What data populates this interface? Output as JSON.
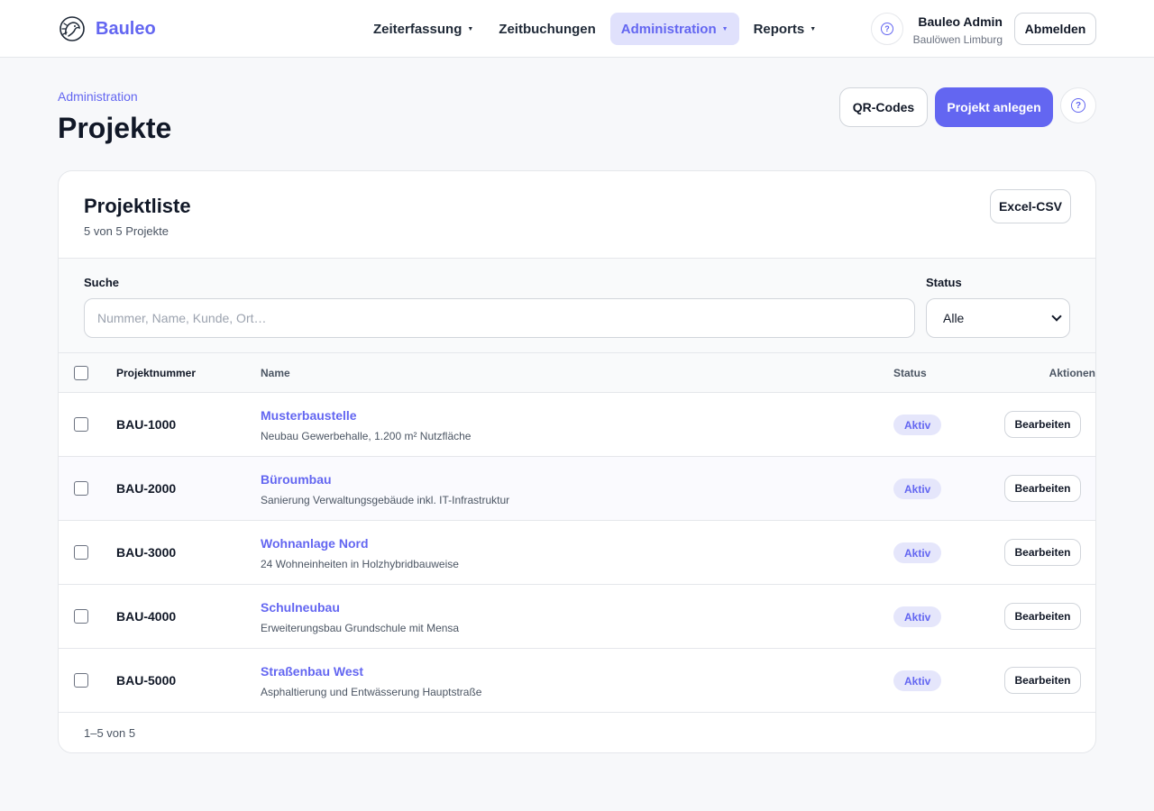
{
  "header": {
    "brand": "Bauleo",
    "nav": [
      {
        "label": "Zeiterfassung",
        "has_dropdown": true,
        "active": false
      },
      {
        "label": "Zeitbuchungen",
        "has_dropdown": false,
        "active": false
      },
      {
        "label": "Administration",
        "has_dropdown": true,
        "active": true
      },
      {
        "label": "Reports",
        "has_dropdown": true,
        "active": false
      }
    ],
    "user_name": "Bauleo Admin",
    "user_org": "Baulöwen Limburg",
    "logout_label": "Abmelden"
  },
  "page": {
    "breadcrumb": "Administration",
    "title": "Projekte",
    "qr_label": "QR-Codes",
    "create_label": "Projekt anlegen"
  },
  "card": {
    "title": "Projektliste",
    "subtitle": "5 von 5 Projekte",
    "export_label": "Excel-CSV",
    "search_label": "Suche",
    "search_placeholder": "Nummer, Name, Kunde, Ort…",
    "search_value": "",
    "status_label": "Status",
    "status_value": "Alle",
    "columns": [
      "Projektnummer",
      "Name",
      "Status",
      "Aktionen"
    ],
    "rows": [
      {
        "number": "BAU-1000",
        "name": "Musterbaustelle",
        "description": "Neubau Gewerbehalle, 1.200 m² Nutzfläche",
        "status": "Aktiv",
        "action": "Bearbeiten"
      },
      {
        "number": "BAU-2000",
        "name": "Büroumbau",
        "description": "Sanierung Verwaltungsgebäude inkl. IT-Infrastruktur",
        "status": "Aktiv",
        "action": "Bearbeiten"
      },
      {
        "number": "BAU-3000",
        "name": "Wohnanlage Nord",
        "description": "24 Wohneinheiten in Holzhybridbauweise",
        "status": "Aktiv",
        "action": "Bearbeiten"
      },
      {
        "number": "BAU-4000",
        "name": "Schulneubau",
        "description": "Erweiterungsbau Grundschule mit Mensa",
        "status": "Aktiv",
        "action": "Bearbeiten"
      },
      {
        "number": "BAU-5000",
        "name": "Straßenbau West",
        "description": "Asphaltierung und Entwässerung Hauptstraße",
        "status": "Aktiv",
        "action": "Bearbeiten"
      }
    ],
    "pagination": "1–5 von 5"
  },
  "colors": {
    "accent": "#6366f1",
    "accent_light": "#e0e1fc",
    "background": "#f7f8fa",
    "text": "#111827"
  },
  "icons": {
    "brand": "lion-logo-icon",
    "help": "help-circle-icon",
    "dropdown": "caret-down-icon"
  }
}
